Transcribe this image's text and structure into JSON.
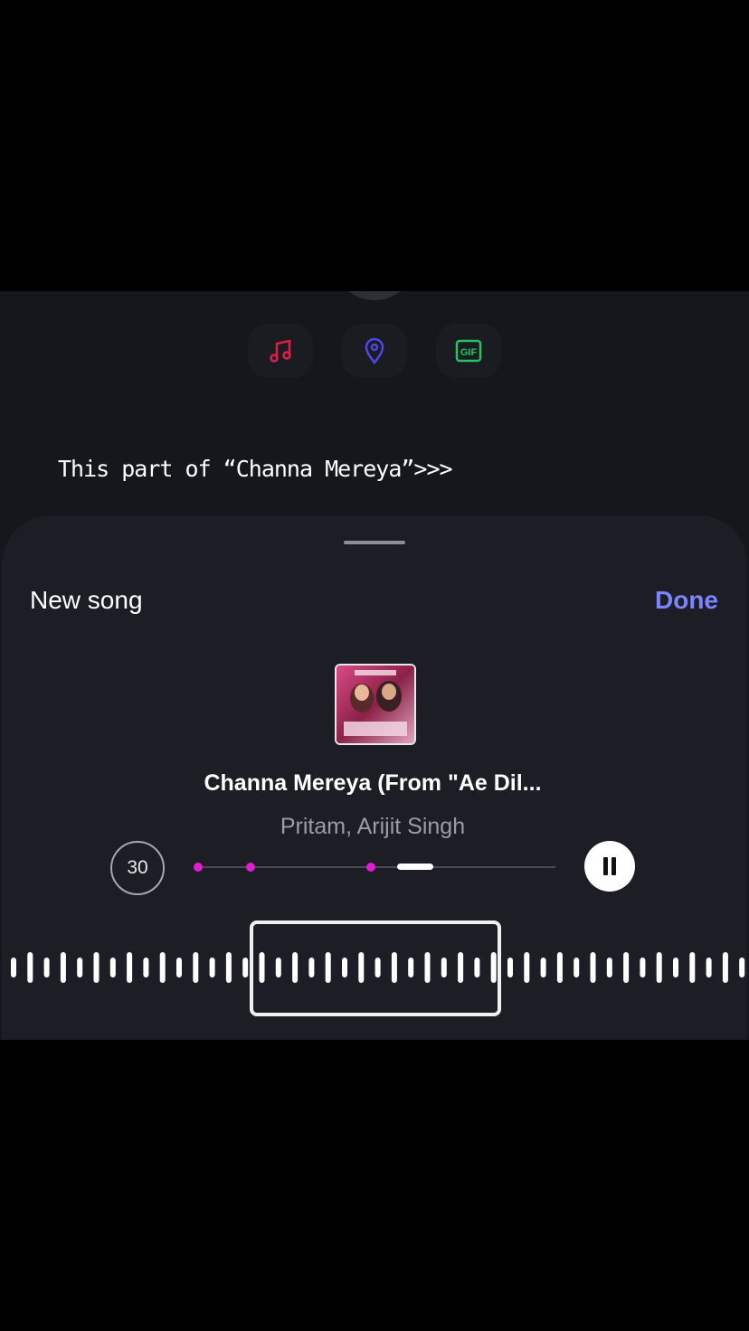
{
  "caption": "This part of “Channa Mereya”>>>",
  "stickers": [
    {
      "icon": "music-note-icon",
      "color": "#e11d48"
    },
    {
      "icon": "location-pin-icon",
      "color": "#4f46e5"
    },
    {
      "icon": "gif-icon",
      "color": "#22c55e",
      "label": "GIF"
    }
  ],
  "sheet": {
    "title": "New song",
    "done_label": "Done"
  },
  "song": {
    "title": "Channa Mereya (From \"Ae Dil...",
    "artist": "Pritam, Arijit Singh",
    "duration": "30",
    "marker_positions": [
      0.0,
      0.145,
      0.48
    ],
    "playhead_position": 0.61,
    "is_playing": true
  },
  "colors": {
    "accent": "#7a86ff",
    "marker": "#e01dd1"
  }
}
